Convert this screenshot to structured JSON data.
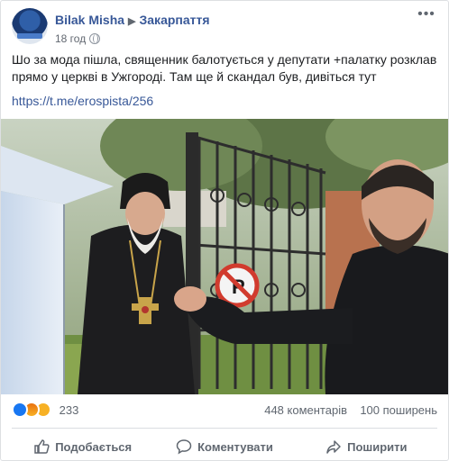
{
  "post": {
    "author": "Bilak Misha",
    "group": "Закарпаття",
    "time": "18 год",
    "text": "Шо за мода пішла, священник балотується у депутати +палатку розклав прямо у церкві в Ужгороді. Там ще й скандал був, дивіться тут",
    "link": "https://t.me/erospista/256"
  },
  "stats": {
    "reactions_count": "233",
    "comments": "448 коментарів",
    "shares": "100 поширень",
    "reaction_icons": [
      "like-icon",
      "angry-icon",
      "wow-icon"
    ]
  },
  "actions": {
    "like": "Подобається",
    "comment": "Коментувати",
    "share": "Поширити"
  },
  "colors": {
    "link": "#385898",
    "like": "#1877f2",
    "secondary_text": "#606770"
  }
}
